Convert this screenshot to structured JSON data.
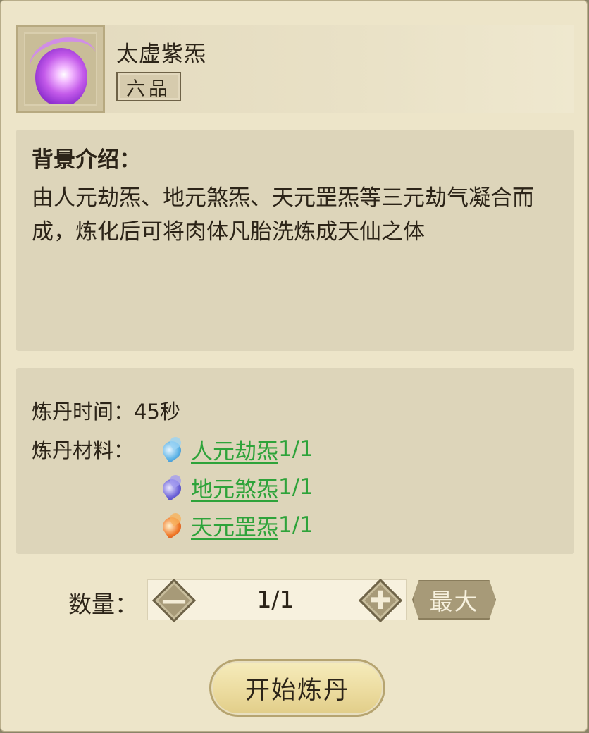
{
  "item": {
    "name": "太虚紫炁",
    "grade": "六品",
    "icon": "purple-orb-icon"
  },
  "background": {
    "title": "背景介绍：",
    "text": "由人元劫炁、地元煞炁、天元罡炁等三元劫气凝合而成，炼化后可将肉体凡胎洗炼成天仙之体"
  },
  "refine": {
    "time_label": "炼丹时间：",
    "time_value": "45秒",
    "materials_label": "炼丹材料：",
    "materials": [
      {
        "name": "人元劫炁",
        "count": "1/1",
        "icon": "blue-flame-icon",
        "color": "#5fb4e6"
      },
      {
        "name": "地元煞炁",
        "count": "1/1",
        "icon": "violet-flame-icon",
        "color": "#6d63d8"
      },
      {
        "name": "天元罡炁",
        "count": "1/1",
        "icon": "orange-flame-icon",
        "color": "#f07a2a"
      }
    ]
  },
  "quantity": {
    "label": "数量：",
    "value": "1/1",
    "minus_glyph": "—",
    "plus_glyph": "✚",
    "max_label": "最大"
  },
  "actions": {
    "start_label": "开始炼丹"
  },
  "colors": {
    "link_green": "#2ea33a",
    "panel_bg": "#ede5c9",
    "box_bg": "#ddd5ba"
  }
}
